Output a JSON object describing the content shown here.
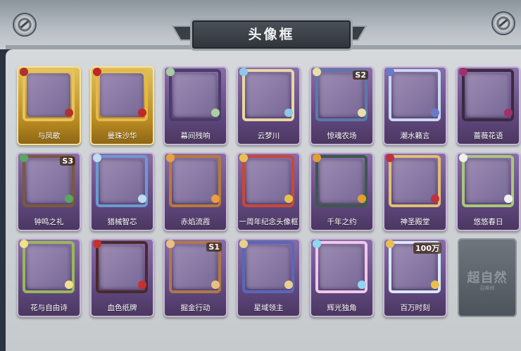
{
  "title": "头像框",
  "frames": [
    {
      "label": "与凤歌",
      "theme": "gold",
      "border": "#e8c25a",
      "accent": "#b03030"
    },
    {
      "label": "曼珠沙华",
      "theme": "gold",
      "border": "#e6b84a",
      "accent": "#c02828"
    },
    {
      "label": "幕间残响",
      "theme": "purple",
      "border": "#4a3c6a",
      "accent": "#a8d0a0"
    },
    {
      "label": "云梦川",
      "theme": "purple",
      "border": "#e8d8a0",
      "accent": "#8ec8e8"
    },
    {
      "label": "惊魂农场",
      "theme": "purple",
      "border": "#5a7aa8",
      "accent": "#e8e0a8",
      "badge": "S2"
    },
    {
      "label": "潮水籁言",
      "theme": "purple",
      "border": "#c8d8f0",
      "accent": "#6a7ac8"
    },
    {
      "label": "蔷薇花语",
      "theme": "purple",
      "border": "#3a2a3e",
      "accent": "#a0306a"
    },
    {
      "label": "钟鸣之礼",
      "theme": "purple",
      "border": "#7a5a3a",
      "accent": "#58a860",
      "badge": "S3"
    },
    {
      "label": "猎械智芯",
      "theme": "purple",
      "border": "#6a9ad0",
      "accent": "#c0dcf0"
    },
    {
      "label": "赤焰流霞",
      "theme": "purple",
      "border": "#b87a38",
      "accent": "#e8a040"
    },
    {
      "label": "一周年纪念头像框",
      "theme": "purple",
      "border": "#c84838",
      "accent": "#e8c050"
    },
    {
      "label": "千年之约",
      "theme": "purple",
      "border": "#3a5a4a",
      "accent": "#e0a030"
    },
    {
      "label": "神圣殿堂",
      "theme": "purple",
      "border": "#e0c070",
      "accent": "#c03040"
    },
    {
      "label": "悠悠春日",
      "theme": "purple",
      "border": "#a8c878",
      "accent": "#f0f0f0"
    },
    {
      "label": "花与自由诗",
      "theme": "purple",
      "border": "#98b858",
      "accent": "#f0e090"
    },
    {
      "label": "血色纸牌",
      "theme": "purple",
      "border": "#4a2a2a",
      "accent": "#c83030"
    },
    {
      "label": "掘金行动",
      "theme": "purple",
      "border": "#b07848",
      "accent": "#e8c080",
      "badge": "S1"
    },
    {
      "label": "星域领主",
      "theme": "purple",
      "border": "#5868b8",
      "accent": "#e8d090"
    },
    {
      "label": "辉光独角",
      "theme": "purple",
      "border": "#f0c8e8",
      "accent": "#90d8f0"
    },
    {
      "label": "百万时刻",
      "theme": "purple",
      "border": "#d8e8f8",
      "accent": "#e8c050",
      "badge": "100万"
    }
  ],
  "locked_card": {
    "title": "超自然",
    "subtitle": "召唤师"
  }
}
